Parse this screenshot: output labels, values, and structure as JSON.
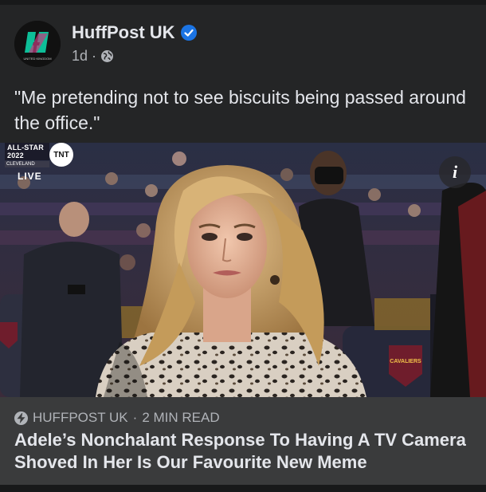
{
  "post": {
    "page_name": "HuffPost UK",
    "timestamp": "1d",
    "separator": "·",
    "audience_icon": "globe-icon",
    "verified_icon": "verified-badge-icon",
    "caption": "\"Me pretending not to see biscuits being passed around the office.\""
  },
  "avatar": {
    "subtext": "UNITED KINGDOM"
  },
  "media": {
    "broadcast_label": "ALL-STAR 2022",
    "score_label": "CLEVELAND",
    "live_label": "LIVE",
    "network_logo": "TNT",
    "seat_logo": "CAVALIERS",
    "info_icon": "i"
  },
  "link_card": {
    "source": "HUFFPOST UK",
    "read_time": "2 MIN READ",
    "dot": "·",
    "title": "Adele’s Nonchalant Response To Having A TV Camera Shoved In Her Is Our Favourite New Meme"
  },
  "colors": {
    "background": "#242526",
    "card": "#3a3b3c",
    "text_primary": "#e4e6eb",
    "text_secondary": "#b0b3b8",
    "verified_blue": "#1b74e4",
    "huffpost_green": "#0dbe98"
  }
}
